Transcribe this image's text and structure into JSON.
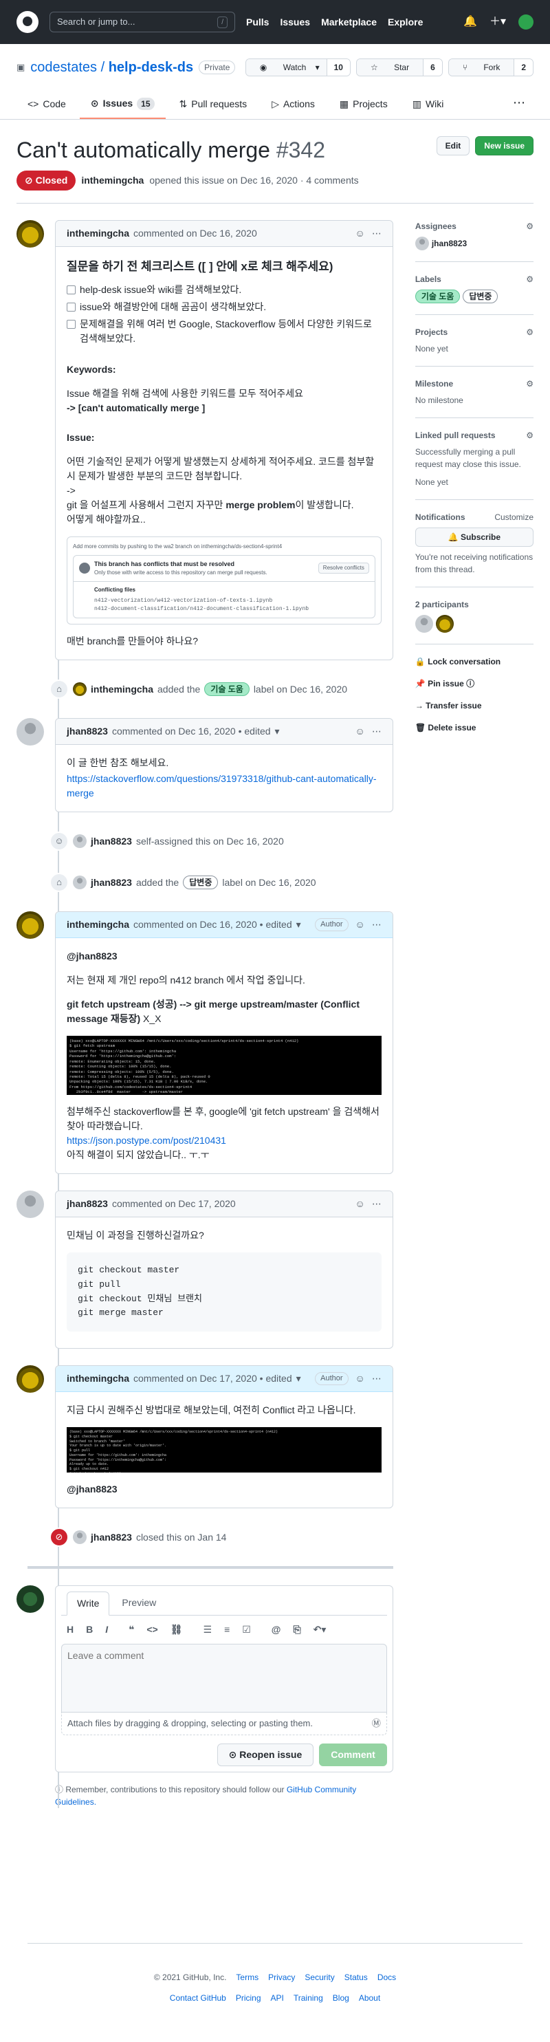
{
  "header": {
    "search_placeholder": "Search or jump to...",
    "slash_key": "/",
    "nav": [
      "Pulls",
      "Issues",
      "Marketplace",
      "Explore"
    ]
  },
  "repo": {
    "owner": "codestates",
    "separator": "/",
    "name": "help-desk-ds",
    "visibility": "Private",
    "watch_label": "Watch",
    "watch_count": "10",
    "star_label": "Star",
    "star_count": "6",
    "fork_label": "Fork",
    "fork_count": "2"
  },
  "tabs": [
    {
      "label": "Code"
    },
    {
      "label": "Issues",
      "count": "15"
    },
    {
      "label": "Pull requests"
    },
    {
      "label": "Actions"
    },
    {
      "label": "Projects"
    },
    {
      "label": "Wiki"
    }
  ],
  "issue": {
    "title": "Can't automatically merge",
    "number": "#342",
    "edit_label": "Edit",
    "new_issue_label": "New issue",
    "status": "Closed",
    "author": "inthemingcha",
    "opened_text": "opened this issue on Dec 16, 2020 · 4 comments"
  },
  "comments": [
    {
      "author": "inthemingcha",
      "meta": "commented on Dec 16, 2020",
      "heading": "질문을 하기 전 체크리스트 ([ ] 안에 x로 체크 해주세요)",
      "tasks": [
        "help-desk issue와 wiki를 검색해보았다.",
        "issue와 해결방안에 대해 곰곰이 생각해보았다.",
        "문제해결을 위해 여러 번 Google, Stackoverflow 등에서 다양한 키워드로 검색해보았다."
      ],
      "keywords_title": "Keywords:",
      "keywords_desc": "Issue 해결을 위해 검색에 사용한 키워드를 모두 적어주세요",
      "keywords_value": "-> [can't automatically merge ]",
      "issue_title": "Issue:",
      "issue_desc": "어떤 기술적인 문제가 어떻게 발생했는지 상세하게 적어주세요. 코드를 첨부할시 문제가 발생한 부분의 코드만 첨부합니다.",
      "issue_arrow": "->",
      "issue_line_pre": "git 을 어설프게 사용해서 그런지 자꾸만 ",
      "issue_line_bold": "merge problem",
      "issue_line_post": "이 발생합니다.",
      "issue_question": "어떻게 해야할까요..",
      "img_top": "Add more commits by pushing to the wa2 branch on inthemingcha/ds-section4-sprint4",
      "img_conflict_title": "This branch has conflicts that must be resolved",
      "img_conflict_sub": "Only those with write access to this repository can merge pull requests.",
      "img_resolve": "Resolve conflicts",
      "img_files_title": "Conflicting files",
      "img_file1": "n412-vectorization/w412-vectorization-of-texts-1.ipynb",
      "img_file2": "n412-document-classification/n412-document-classification-1.ipynb",
      "closing": "매번 branch를 만들어야 하나요?"
    },
    {
      "author": "jhan8823",
      "meta": "commented on Dec 16, 2020 • edited",
      "line1": "이 글 한번 참조 해보세요.",
      "link": "https://stackoverflow.com/questions/31973318/github-cant-automatically-merge"
    },
    {
      "author": "inthemingcha",
      "meta": "commented on Dec 16, 2020 • edited",
      "badge": "Author",
      "mention": "@jhan8823",
      "line1": "저는 현재 제 개인 repo의 n412 branch 에서 작업 중입니다.",
      "bold_line": "git fetch upstream (성공) --> git merge upstream/master (Conflict message 재등장)",
      "bold_suffix": " X_X",
      "terminal": "(base) xxx@LAPTOP-XXXXXXX MINGW64 /mnt/c/Users/xxx/coding/section4/sprint4/ds-section4-sprint4 (n412)\n$ git fetch upstream\nUsername for 'https://github.com': inthemingcha\nPassword for 'https://inthemingcha@github.com':\nremote: Enumerating objects: 15, done.\nremote: Counting objects: 100% (15/15), done.\nremote: Compressing objects: 100% (5/5), done.\nremote: Total 15 (delta 8), reused 15 (delta 8), pack-reused 0\nUnpacking objects: 100% (15/15), 7.31 KiB | 7.00 KiB/s, done.\nFrom https://github.com/codestates/ds-section4-sprint4\n   2b3f9c1..8ce4f8d  master     -> upstream/master\n$ git merge upstream/master\nAuto-merging n412-vectorization/w412-vectorization-of-texts-1.ipynb\nCONFLICT (content): Merge conflict in n412-document-classification/n412-document-classification-1.ipynb\nAuto-merging n412-vectorization/n412-vectorization-of-texts-1.ipynb\nCONFLICT (content): Merge conflict in n412-vectorization/n412-vectorization-of-texts-1.ipynb\nAutomatic merge failed; fix conflicts and then commit the result.\n$",
      "line2": "첨부해주신 stackoverflow를 본 후, google에 'git fetch upstream' 을 검색해서 찾아 따라했습니다.",
      "link": "https://json.postype.com/post/210431",
      "line3": "아직 해결이 되지 않았습니다.. ㅜ.ㅜ"
    },
    {
      "author": "jhan8823",
      "meta": "commented on Dec 17, 2020",
      "line1": "민채님 이 과정을 진행하신걸까요?",
      "code": "git checkout master\ngit pull\ngit checkout 민채님 브랜치\ngit merge master"
    },
    {
      "author": "inthemingcha",
      "meta": "commented on Dec 17, 2020 • edited",
      "badge": "Author",
      "line1": "지금 다시 권해주신 방법대로 해보았는데, 여전히 Conflict 라고 나옵니다.",
      "terminal": "(base) xxx@LAPTOP-XXXXXXX MINGW64 /mnt/c/Users/xxx/coding/section4/sprint4/ds-section4-sprint4 (n412)\n$ git checkout master\nSwitched to branch 'master'\nYour branch is up to date with 'origin/master'.\n$ git pull\nUsername for 'https://github.com': inthemingcha\nPassword for 'https://inthemingcha@github.com':\nAlready up to date.\n$ git checkout n412\nSwitched to branch 'n412'\n$ git merge master\nCONFLICT (rename/delete): n412-vectorization/n412-vectorization-of-texts-1.ipynb deleted in HEAD and renamed to\n n412-vectorization/n412-vectorization-of-texts-2.ipynb in master. Version master of n412-vectorization-of-texts-2.ipynb left in tree.\nAutomatic merge failed; fix conflicts and then commit the result.\n$",
      "mention": "@jhan8823"
    }
  ],
  "events": {
    "label1": {
      "actor": "inthemingcha",
      "pre": "added the",
      "label": "기술 도움",
      "post": "label on Dec 16, 2020"
    },
    "assign": {
      "actor": "jhan8823",
      "text": "self-assigned this on Dec 16, 2020"
    },
    "label2": {
      "actor": "jhan8823",
      "pre": "added the",
      "label": "답변중",
      "post": "label on Dec 16, 2020"
    },
    "closed": {
      "actor": "jhan8823",
      "text": "closed this on Jan 14"
    }
  },
  "new_comment": {
    "tab_write": "Write",
    "tab_preview": "Preview",
    "placeholder": "Leave a comment",
    "attach_text": "Attach files by dragging & dropping, selecting or pasting them.",
    "reopen_label": "Reopen issue",
    "comment_label": "Comment",
    "remember_text": "Remember, contributions to this repository should follow our",
    "guidelines_link": "GitHub Community Guidelines."
  },
  "sidebar": {
    "assignees_title": "Assignees",
    "assignee": "jhan8823",
    "labels_title": "Labels",
    "labels": [
      "기술 도움",
      "답변중"
    ],
    "projects_title": "Projects",
    "projects_value": "None yet",
    "milestone_title": "Milestone",
    "milestone_value": "No milestone",
    "linked_title": "Linked pull requests",
    "linked_desc": "Successfully merging a pull request may close this issue.",
    "linked_value": "None yet",
    "notifications_title": "Notifications",
    "customize": "Customize",
    "subscribe": "Subscribe",
    "notif_desc": "You're not receiving notifications from this thread.",
    "participants_title": "2 participants",
    "actions": [
      "Lock conversation",
      "Pin issue",
      "Transfer issue",
      "Delete issue"
    ]
  },
  "footer": {
    "copyright": "© 2021 GitHub, Inc.",
    "row1": [
      "Terms",
      "Privacy",
      "Security",
      "Status",
      "Docs"
    ],
    "row2": [
      "Contact GitHub",
      "Pricing",
      "API",
      "Training",
      "Blog",
      "About"
    ]
  },
  "colors": {
    "accent": "#0969da",
    "closed": "#cf222e",
    "green": "#2da44e"
  }
}
